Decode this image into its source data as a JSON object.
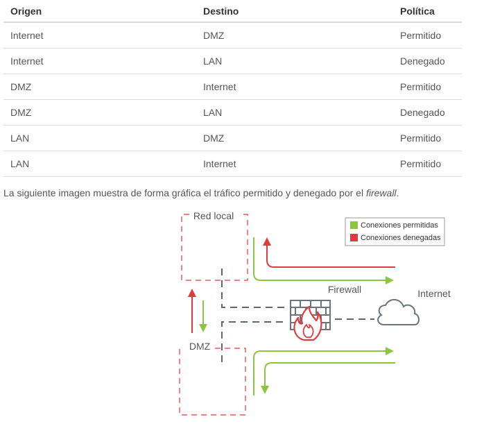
{
  "table": {
    "headers": [
      "Origen",
      "Destino",
      "Política"
    ],
    "rows": [
      [
        "Internet",
        "DMZ",
        "Permitido"
      ],
      [
        "Internet",
        "LAN",
        "Denegado"
      ],
      [
        "DMZ",
        "Internet",
        "Permitido"
      ],
      [
        "DMZ",
        "LAN",
        "Denegado"
      ],
      [
        "LAN",
        "DMZ",
        "Permitido"
      ],
      [
        "LAN",
        "Internet",
        "Permitido"
      ]
    ]
  },
  "caption": {
    "text": "La siguiente imagen muestra de forma gráfica el tráfico permitido y denegado por el ",
    "emphasis": "firewall",
    "end": "."
  },
  "diagram": {
    "lan_label": "Red local",
    "dmz_label": "DMZ",
    "firewall_label": "Firewall",
    "internet_label": "Internet",
    "legend": {
      "allowed": "Conexiones permitidas",
      "denied": "Conexiones denegadas"
    },
    "colors": {
      "allowed": "#8cc63f",
      "denied": "#e0393e",
      "zone_border": "#e0393e",
      "link": "#5a6670",
      "firewall": "#6b747c"
    }
  }
}
